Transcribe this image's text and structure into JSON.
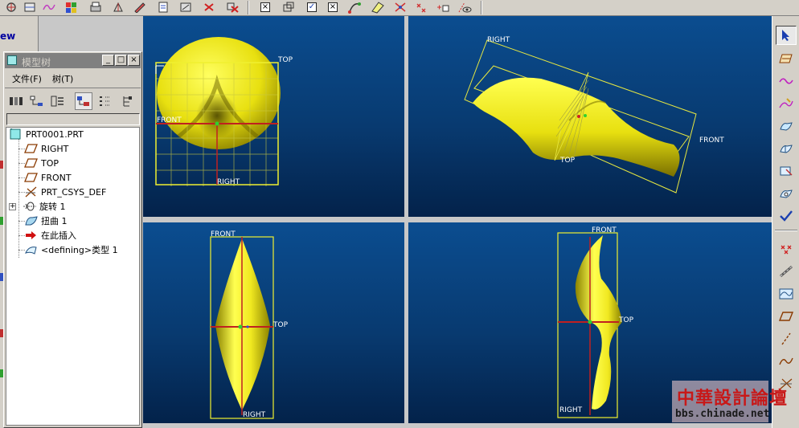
{
  "left_strip": {
    "view_label": "ew"
  },
  "model_tree": {
    "title": "模型树",
    "controls": {
      "minimize": "_",
      "maximize": "□",
      "close": "×"
    },
    "menu": [
      {
        "label": "文件(F)"
      },
      {
        "label": "树(T)"
      }
    ],
    "nodes": [
      {
        "label": "PRT0001.PRT",
        "icon": "part-icon"
      },
      {
        "label": "RIGHT",
        "icon": "datum-plane-icon"
      },
      {
        "label": "TOP",
        "icon": "datum-plane-icon"
      },
      {
        "label": "FRONT",
        "icon": "datum-plane-icon"
      },
      {
        "label": "PRT_CSYS_DEF",
        "icon": "coordinate-system-icon"
      },
      {
        "label": "旋转 1",
        "icon": "revolve-feature-icon",
        "expander": "+"
      },
      {
        "label": "扭曲 1",
        "icon": "warp-feature-icon"
      },
      {
        "label": "在此插入",
        "icon": "insert-here-arrow-icon"
      },
      {
        "label": "<defining>类型 1",
        "icon": "style-feature-icon"
      }
    ]
  },
  "viewports": {
    "top_left": {
      "labels": {
        "top": "TOP",
        "front": "FRONT",
        "right": "RIGHT"
      }
    },
    "top_right": {
      "labels": {
        "right": "RIGHT",
        "front": "FRONT",
        "top": "TOP"
      }
    },
    "bottom_left": {
      "labels": {
        "front": "FRONT",
        "top": "TOP",
        "right": "RIGHT"
      }
    },
    "bottom_right": {
      "labels": {
        "front": "FRONT",
        "top": "TOP",
        "right": "RIGHT"
      }
    }
  },
  "watermark": {
    "title": "中華設計論壇",
    "url": "bbs.chinade.net"
  },
  "colors": {
    "viewport_top": "#0b4d90",
    "viewport_bottom": "#03224a",
    "datum": "#e8e840",
    "surface": "#ffff20",
    "axis": "#c02020"
  }
}
